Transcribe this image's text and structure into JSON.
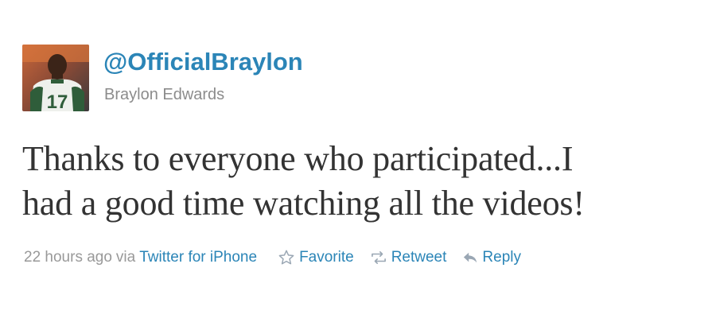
{
  "author": {
    "screen_name": "@OfficialBraylon",
    "full_name": "Braylon Edwards",
    "avatar_icon": "profile-photo",
    "jersey_number": "17"
  },
  "tweet": {
    "lines": [
      "Thanks to everyone who participated...I",
      "had a good time watching all the videos!"
    ]
  },
  "meta": {
    "timestamp": "22 hours ago",
    "via_label": "via",
    "source": "Twitter for iPhone"
  },
  "actions": [
    {
      "label": "Favorite",
      "icon": "star-icon"
    },
    {
      "label": "Retweet",
      "icon": "retweet-icon"
    },
    {
      "label": "Reply",
      "icon": "reply-icon"
    }
  ],
  "colors": {
    "link": "#2b85b7",
    "secondary_text": "#999999",
    "tweet_text": "#333333"
  }
}
